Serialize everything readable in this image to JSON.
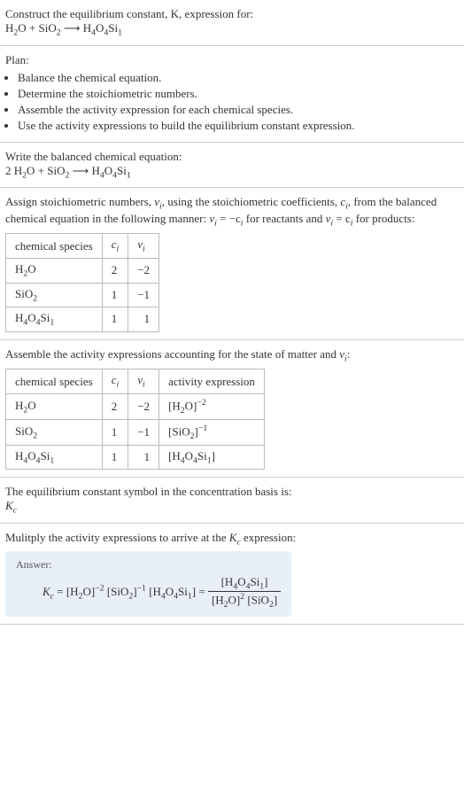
{
  "construct": {
    "heading": "Construct the equilibrium constant, K, expression for:",
    "equation_lhs1": "H",
    "equation_lhs1_sub": "2",
    "equation_lhs2": "O + SiO",
    "equation_lhs2_sub": "2",
    "arrow": " ⟶ ",
    "equation_rhs": "H",
    "equation_rhs_sub1": "4",
    "equation_rhs2": "O",
    "equation_rhs_sub2": "4",
    "equation_rhs3": "Si",
    "equation_rhs_sub3": "1"
  },
  "plan": {
    "heading": "Plan:",
    "items": [
      "Balance the chemical equation.",
      "Determine the stoichiometric numbers.",
      "Assemble the activity expression for each chemical species.",
      "Use the activity expressions to build the equilibrium constant expression."
    ]
  },
  "balanced": {
    "heading": "Write the balanced chemical equation:",
    "coef": "2 ",
    "lhs1": "H",
    "lhs1s": "2",
    "lhs2": "O + SiO",
    "lhs2s": "2",
    "arrow": " ⟶ ",
    "rhs1": "H",
    "rhs1s": "4",
    "rhs2": "O",
    "rhs2s": "4",
    "rhs3": "Si",
    "rhs3s": "1"
  },
  "assign": {
    "text1": "Assign stoichiometric numbers, ",
    "nu": "ν",
    "nu_sub": "i",
    "text2": ", using the stoichiometric coefficients, ",
    "c": "c",
    "c_sub": "i",
    "text3": ", from the balanced chemical equation in the following manner: ",
    "rel1a": "ν",
    "rel1b": "i",
    "rel1c": " = −c",
    "rel1d": "i",
    "text4": " for reactants and ",
    "rel2a": "ν",
    "rel2b": "i",
    "rel2c": " = c",
    "rel2d": "i",
    "text5": " for products:"
  },
  "table1": {
    "h1": "chemical species",
    "h2": "c",
    "h2s": "i",
    "h3": "ν",
    "h3s": "i",
    "rows": [
      {
        "sp_a": "H",
        "sp_as": "2",
        "sp_b": "O",
        "sp_bs": "",
        "sp_c": "",
        "sp_cs": "",
        "c": "2",
        "nu": "−2"
      },
      {
        "sp_a": "SiO",
        "sp_as": "2",
        "sp_b": "",
        "sp_bs": "",
        "sp_c": "",
        "sp_cs": "",
        "c": "1",
        "nu": "−1"
      },
      {
        "sp_a": "H",
        "sp_as": "4",
        "sp_b": "O",
        "sp_bs": "4",
        "sp_c": "Si",
        "sp_cs": "1",
        "c": "1",
        "nu": "1"
      }
    ]
  },
  "assemble": {
    "text1": "Assemble the activity expressions accounting for the state of matter and ",
    "nu": "ν",
    "nu_s": "i",
    "text2": ":"
  },
  "table2": {
    "h1": "chemical species",
    "h2": "c",
    "h2s": "i",
    "h3": "ν",
    "h3s": "i",
    "h4": "activity expression",
    "rows": [
      {
        "sp_a": "H",
        "sp_as": "2",
        "sp_b": "O",
        "sp_bs": "",
        "sp_c": "",
        "sp_cs": "",
        "c": "2",
        "nu": "−2",
        "act_pre": "[H",
        "act_s1": "2",
        "act_mid": "O]",
        "act_exp": "−2",
        "act_post": ""
      },
      {
        "sp_a": "SiO",
        "sp_as": "2",
        "sp_b": "",
        "sp_bs": "",
        "sp_c": "",
        "sp_cs": "",
        "c": "1",
        "nu": "−1",
        "act_pre": "[SiO",
        "act_s1": "2",
        "act_mid": "]",
        "act_exp": "−1",
        "act_post": ""
      },
      {
        "sp_a": "H",
        "sp_as": "4",
        "sp_b": "O",
        "sp_bs": "4",
        "sp_c": "Si",
        "sp_cs": "1",
        "c": "1",
        "nu": "1",
        "act_pre": "[H",
        "act_s1": "4",
        "act_mid": "O",
        "act_s2": "4",
        "act_mid2": "Si",
        "act_s3": "1",
        "act_mid3": "]",
        "act_exp": "",
        "act_post": ""
      }
    ]
  },
  "symbol": {
    "text": "The equilibrium constant symbol in the concentration basis is:",
    "K": "K",
    "Ks": "c"
  },
  "multiply": {
    "text1": "Mulitply the activity expressions to arrive at the ",
    "K": "K",
    "Ks": "c",
    "text2": " expression:"
  },
  "answer": {
    "label": "Answer:",
    "Kc_K": "K",
    "Kc_s": "c",
    "eq": " = ",
    "t1": "[H",
    "t1s": "2",
    "t2": "O]",
    "t2e": "−2",
    "sp1": " ",
    "t3": "[SiO",
    "t3s": "2",
    "t4": "]",
    "t4e": "−1",
    "sp2": " ",
    "t5": "[H",
    "t5s": "4",
    "t6": "O",
    "t6s": "4",
    "t7": "Si",
    "t7s": "1",
    "t8": "]",
    "eq2": " = ",
    "num1": "[H",
    "num1s": "4",
    "num2": "O",
    "num2s": "4",
    "num3": "Si",
    "num3s": "1",
    "num4": "]",
    "den1": "[H",
    "den1s": "2",
    "den2": "O]",
    "den2e": "2",
    "den_sp": " ",
    "den3": "[SiO",
    "den3s": "2",
    "den4": "]"
  }
}
